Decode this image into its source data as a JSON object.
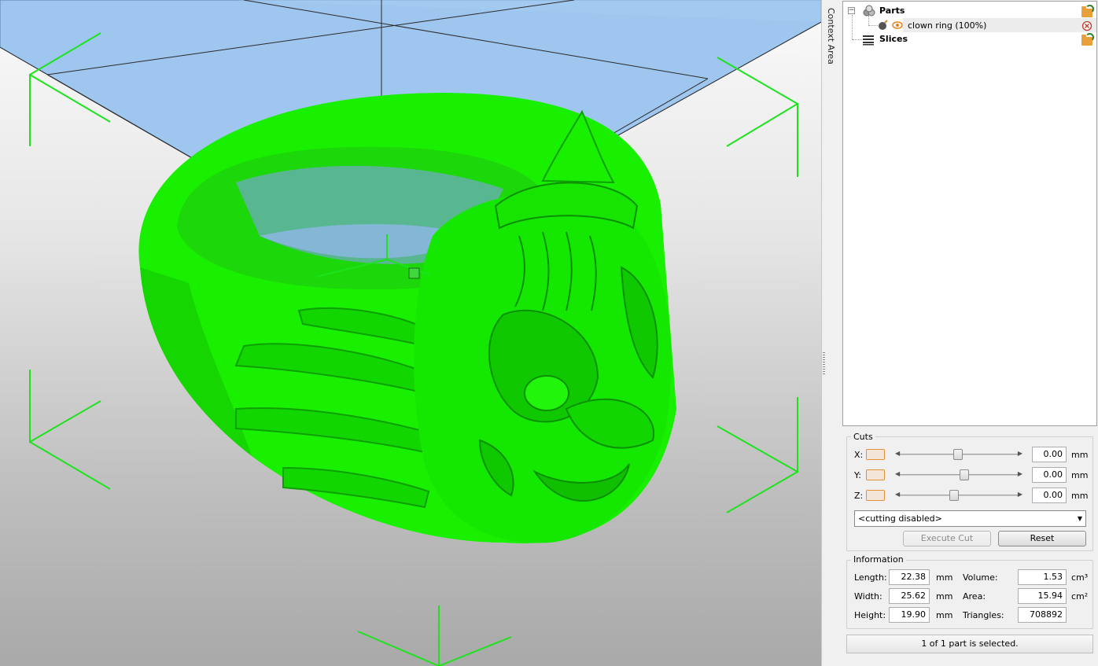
{
  "viewport": {
    "model_name": "clown ring",
    "colors": {
      "model": "#19f000",
      "plate": "#9ec6ee",
      "bounding_box": "#1fe21f",
      "background_top": "#fafafa",
      "background_bottom": "#a9a9a9"
    }
  },
  "context_tab": {
    "label": "Context Area"
  },
  "tree": {
    "parts_label": "Parts",
    "part_item_label": "clown ring (100%)",
    "slices_label": "Slices",
    "icons": {
      "parts": "spheres-icon",
      "part": "bomb-icon",
      "visibility": "eye-icon",
      "remove": "close-circle-icon",
      "slices": "layers-icon",
      "load": "folder-open-icon"
    }
  },
  "cuts": {
    "title": "Cuts",
    "x": {
      "label": "X:",
      "value": "0.00",
      "unit": "mm",
      "slider_fraction": 0.49
    },
    "y": {
      "label": "Y:",
      "value": "0.00",
      "unit": "mm",
      "slider_fraction": 0.55
    },
    "z": {
      "label": "Z:",
      "value": "0.00",
      "unit": "mm",
      "slider_fraction": 0.46
    },
    "mode": "<cutting disabled>",
    "execute_label": "Execute Cut",
    "reset_label": "Reset"
  },
  "information": {
    "title": "Information",
    "length": {
      "label": "Length:",
      "value": "22.38",
      "unit": "mm"
    },
    "width": {
      "label": "Width:",
      "value": "25.62",
      "unit": "mm"
    },
    "height": {
      "label": "Height:",
      "value": "19.90",
      "unit": "mm"
    },
    "volume": {
      "label": "Volume:",
      "value": "1.53",
      "unit": "cm³"
    },
    "area": {
      "label": "Area:",
      "value": "15.94",
      "unit": "cm²"
    },
    "triangles": {
      "label": "Triangles:",
      "value": "708892"
    }
  },
  "status": {
    "text": "1 of 1 part is selected."
  }
}
